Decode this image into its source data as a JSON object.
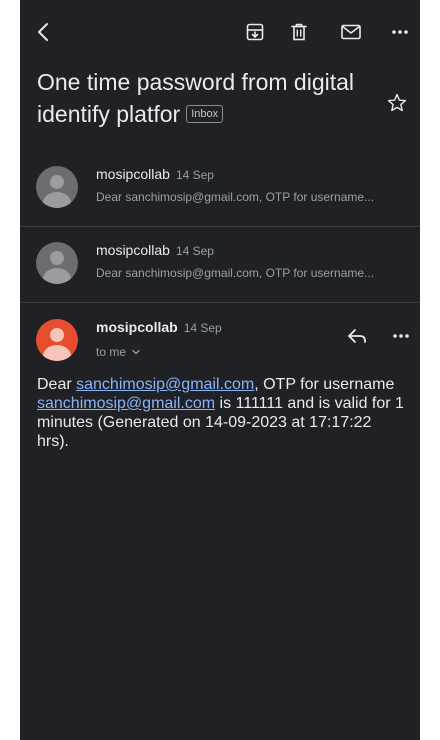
{
  "toolbar": {
    "back_icon": "chevron-left-icon",
    "archive_icon": "archive-icon",
    "delete_icon": "trash-icon",
    "mark_unread_icon": "mail-icon",
    "more_icon": "more-horizontal-icon"
  },
  "subject": {
    "title": "One time password from digital identify platfor",
    "label_chip": "Inbox",
    "star_icon": "star-outline-icon"
  },
  "messages": [
    {
      "sender": "mosipcollab",
      "date": "14 Sep",
      "snippet": "Dear sanchimosip@gmail.com, OTP for username..."
    },
    {
      "sender": "mosipcollab",
      "date": "14 Sep",
      "snippet": "Dear sanchimosip@gmail.com, OTP for username..."
    }
  ],
  "open_message": {
    "sender": "mosipcollab",
    "date": "14 Sep",
    "recipient": "to me",
    "body": {
      "t1": "Dear ",
      "link1": "sanchimosip@gmail.com",
      "t2": ", OTP for username ",
      "link2": "sanchimosip@gmail.com",
      "t3": " is 111111 and is valid for 1 minutes (Generated on 14-09-2023 at 17:17:22 hrs)."
    }
  },
  "colors": {
    "background": "#1f2125",
    "link": "#8ab4f8",
    "avatar_red": "#e64d2e",
    "avatar_grey": "#6b6d70"
  }
}
